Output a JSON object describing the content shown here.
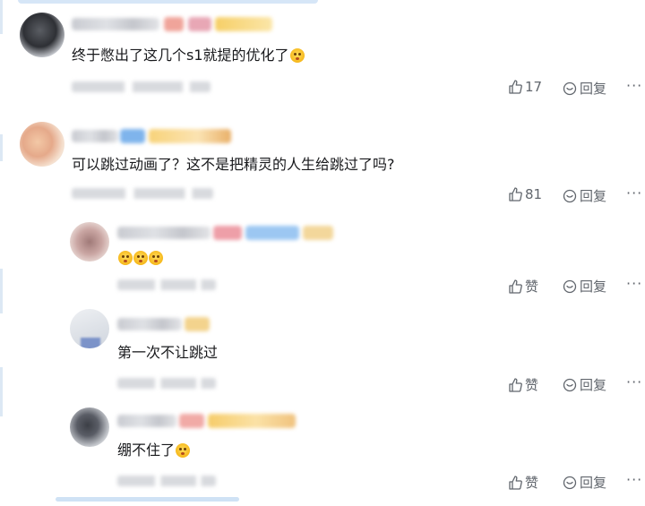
{
  "comments": [
    {
      "text": "终于憋出了这几个s1就提的优化了",
      "trailing_emoji": "emoji-icon",
      "like_label": "17",
      "reply_label": "回复",
      "more_label": "···"
    },
    {
      "text": "可以跳过动画了？这不是把精灵的人生给跳过了吗?",
      "like_label": "81",
      "reply_label": "回复",
      "more_label": "···",
      "replies": [
        {
          "text": "",
          "emoji_count": 3,
          "like_label": "赞",
          "reply_label": "回复",
          "more_label": "···"
        },
        {
          "text": "第一次不让跳过",
          "like_label": "赞",
          "reply_label": "回复",
          "more_label": "···"
        },
        {
          "text": "绷不住了",
          "trailing_emoji": "emoji-icon",
          "like_label": "赞",
          "reply_label": "回复",
          "more_label": "···"
        }
      ]
    }
  ],
  "colors": {
    "text": "#18191c",
    "secondary": "#61666d",
    "accent_blue": "#00a1d6"
  }
}
